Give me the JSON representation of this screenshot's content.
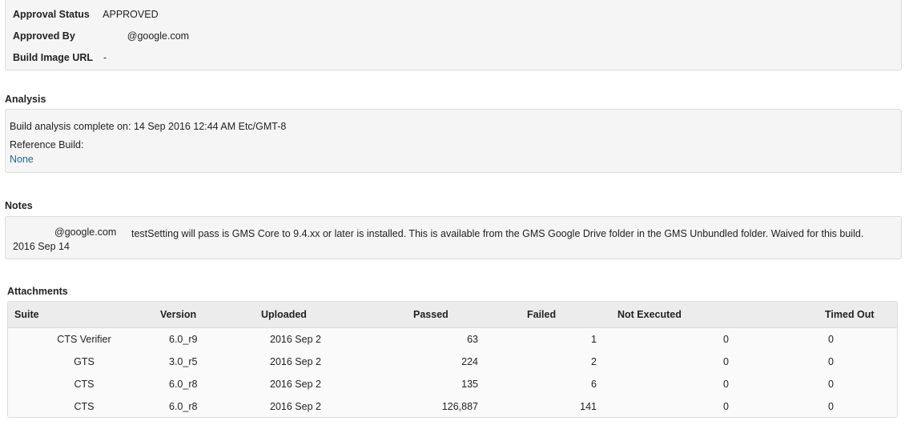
{
  "approval": {
    "status_label": "Approval Status",
    "status_value": "APPROVED",
    "approved_by_label": "Approved By",
    "approved_by_value": "@google.com",
    "build_image_label": "Build Image URL",
    "build_image_value": "-"
  },
  "analysis": {
    "title": "Analysis",
    "complete_text": "Build analysis complete on: 14 Sep 2016 12:44 AM Etc/GMT-8",
    "reference_label": "Reference Build:",
    "reference_value": "None"
  },
  "notes": {
    "title": "Notes",
    "author": "@google.com",
    "date": "2016 Sep 14",
    "text": "testSetting will pass is GMS Core to 9.4.xx or later is installed. This is available from the GMS Google Drive folder in the GMS Unbundled folder. Waived for this build."
  },
  "attachments": {
    "title": "Attachments",
    "headers": [
      "Suite",
      "Version",
      "Uploaded",
      "Passed",
      "Failed",
      "Not Executed",
      "Timed Out"
    ],
    "rows": [
      [
        "CTS Verifier",
        "6.0_r9",
        "2016 Sep 2",
        "63",
        "1",
        "0",
        "0"
      ],
      [
        "GTS",
        "3.0_r5",
        "2016 Sep 2",
        "224",
        "2",
        "0",
        "0"
      ],
      [
        "CTS",
        "6.0_r8",
        "2016 Sep 2",
        "135",
        "6",
        "0",
        "0"
      ],
      [
        "CTS",
        "6.0_r8",
        "2016 Sep 2",
        "126,887",
        "141",
        "0",
        "0"
      ]
    ]
  }
}
